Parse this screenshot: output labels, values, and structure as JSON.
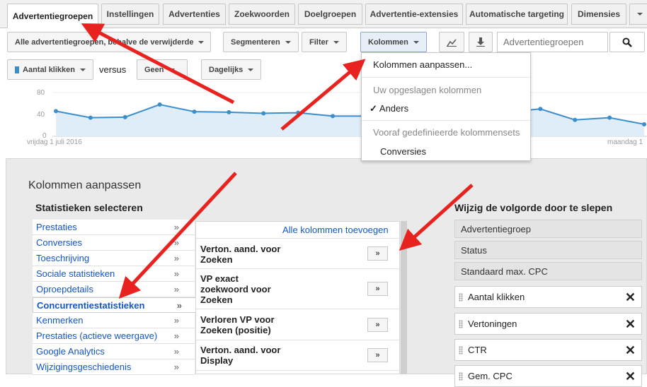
{
  "tabs": [
    {
      "label": "Advertentiegroepen",
      "active": true
    },
    {
      "label": "Instellingen"
    },
    {
      "label": "Advertenties"
    },
    {
      "label": "Zoekwoorden"
    },
    {
      "label": "Doelgroepen"
    },
    {
      "label": "Advertentie-extensies"
    },
    {
      "label": "Automatische targeting"
    },
    {
      "label": "Dimensies"
    }
  ],
  "toolbar": {
    "filter_all": "Alle advertentiegroepen, behalve de verwijderde",
    "segment": "Segmenteren",
    "filter": "Filter",
    "columns": "Kolommen",
    "search_placeholder": "Advertentiegroepen"
  },
  "chart_controls": {
    "metric1": "Aantal klikken",
    "versus": "versus",
    "metric2": "Geen",
    "period": "Dagelijks"
  },
  "chart_data": {
    "type": "line",
    "yticks": [
      80,
      40,
      0
    ],
    "ylim": [
      0,
      80
    ],
    "x_start_label": "vrijdag 1 juli 2016",
    "x_end_label": "maandag 1",
    "series": [
      {
        "values": [
          46,
          34,
          35,
          58,
          45,
          44,
          42,
          43,
          37,
          37,
          38,
          44,
          48,
          44,
          50,
          30,
          34,
          22
        ]
      }
    ],
    "color": "#3c8dcc"
  },
  "columns_menu": {
    "customize": "Kolommen aanpassen...",
    "saved_header": "Uw opgeslagen kolommen",
    "saved_item": "Anders",
    "predefined_header": "Vooraf gedefinieerde kolommensets",
    "predefined_item": "Conversies"
  },
  "panel": {
    "title": "Kolommen aanpassen",
    "stats_heading": "Statistieken selecteren",
    "categories": [
      "Prestaties",
      "Conversies",
      "Toeschrijving",
      "Sociale statistieken",
      "Oproepdetails",
      "Concurrentiestatistieken",
      "Kenmerken",
      "Prestaties (actieve weergave)",
      "Google Analytics",
      "Wijzigingsgeschiedenis"
    ],
    "selected_category": "Concurrentiestatistieken",
    "add_all": "Alle kolommen toevoegen",
    "metrics": [
      "Verton. aand. voor Zoeken",
      "VP exact zoekwoord voor Zoeken",
      "Verloren VP voor Zoeken (positie)",
      "Verton. aand. voor Display"
    ],
    "add_symbol": "»",
    "order_heading": "Wijzig de volgorde door te slepen",
    "fixed_columns": [
      "Advertentiegroep",
      "Status",
      "Standaard max. CPC"
    ],
    "movable_columns": [
      "Aantal klikken",
      "Vertoningen",
      "CTR",
      "Gem. CPC"
    ],
    "remove_symbol": "✕"
  }
}
